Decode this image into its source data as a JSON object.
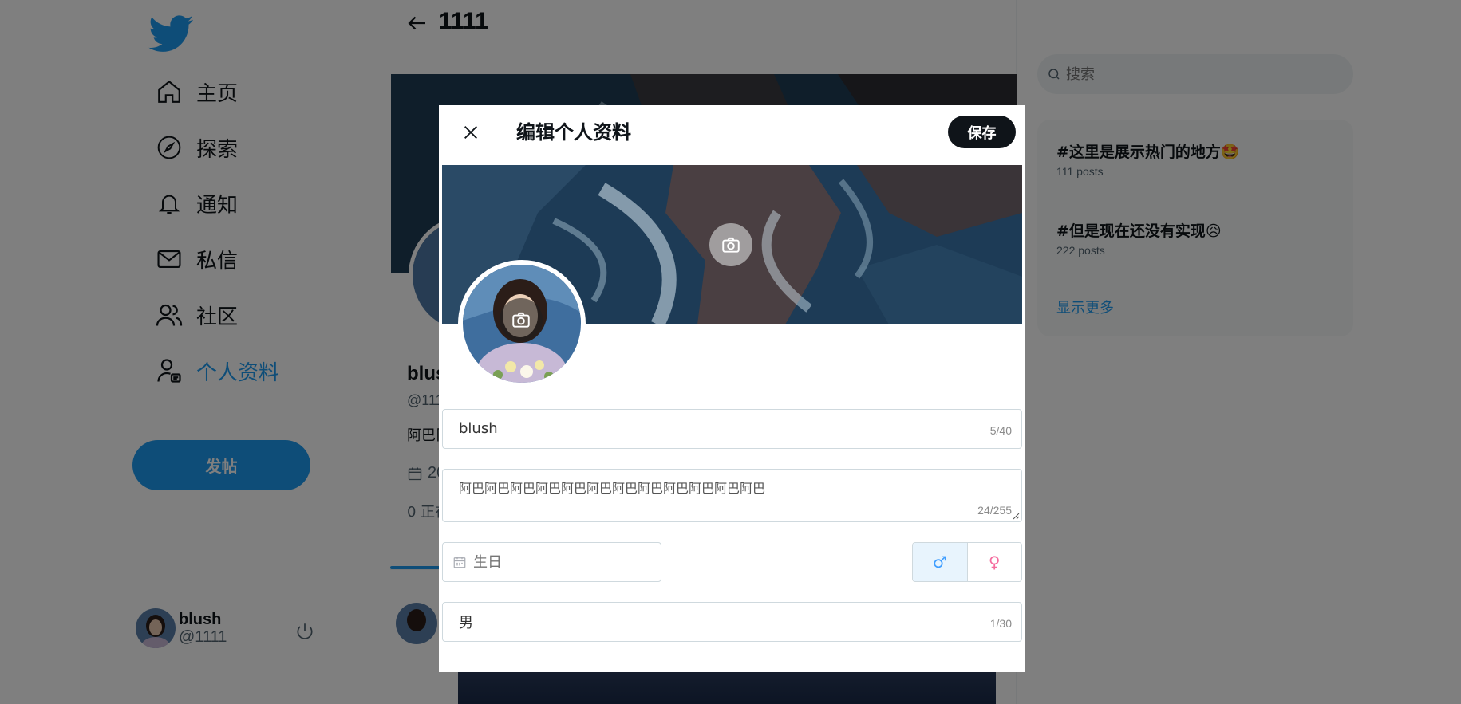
{
  "nav": {
    "items": [
      {
        "label": "主页",
        "icon": "home-icon"
      },
      {
        "label": "探索",
        "icon": "compass-icon"
      },
      {
        "label": "通知",
        "icon": "bell-icon"
      },
      {
        "label": "私信",
        "icon": "mail-icon"
      },
      {
        "label": "社区",
        "icon": "users-icon"
      },
      {
        "label": "个人资料",
        "icon": "profile-icon",
        "active": true
      }
    ],
    "post_label": "发帖"
  },
  "me": {
    "name": "blush",
    "handle": "@1111"
  },
  "main": {
    "title": "1111",
    "profile": {
      "name": "blus",
      "handle": "@111",
      "bio": "阿巴阝",
      "date": "20",
      "follow": "0 正在"
    }
  },
  "right": {
    "search_placeholder": "搜索",
    "trends": [
      {
        "title": "#这里是展示热门的地方🤩",
        "count": "111 posts"
      },
      {
        "title": "#但是现在还没有实现😥",
        "count": "222 posts"
      }
    ],
    "more_label": "显示更多"
  },
  "modal": {
    "title": "编辑个人资料",
    "save_label": "保存",
    "name_value": "blush",
    "name_count": "5/40",
    "bio_value": "阿巴阿巴阿巴阿巴阿巴阿巴阿巴阿巴阿巴阿巴阿巴阿巴",
    "bio_count": "24/255",
    "birthday_placeholder": "生日",
    "gender_male": "♂",
    "gender_female": "♀",
    "gender_selected": "male",
    "gender_text_value": "男",
    "gender_text_count": "1/30"
  },
  "colors": {
    "accent": "#1d9bf0",
    "overlay": "rgba(0,0,0,0.5)",
    "save": "#0f1419"
  }
}
